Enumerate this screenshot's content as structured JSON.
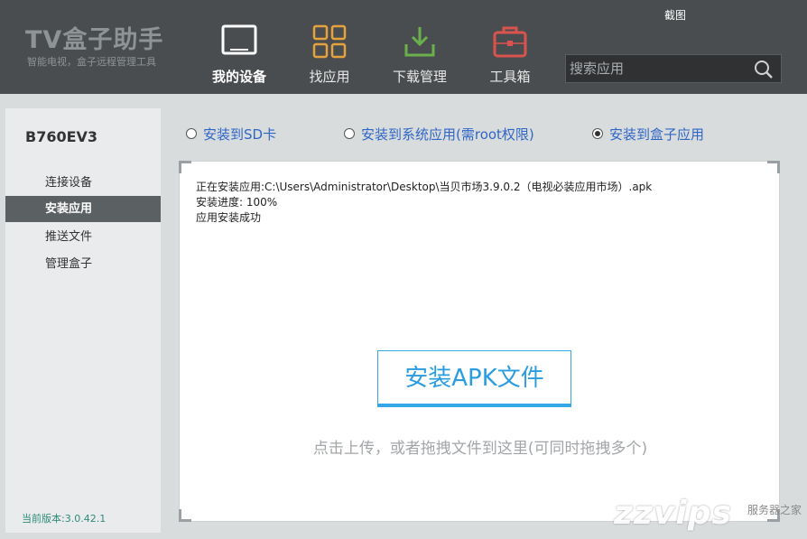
{
  "header": {
    "logo_title": "TV盒子助手",
    "logo_subtitle": "智能电视，盒子远程管理工具",
    "screenshot_label": "截图",
    "search_placeholder": "搜索应用",
    "nav": [
      {
        "label": "我的设备",
        "icon": "tv-icon",
        "active": true
      },
      {
        "label": "找应用",
        "icon": "grid-icon",
        "active": false
      },
      {
        "label": "下载管理",
        "icon": "download-icon",
        "active": false
      },
      {
        "label": "工具箱",
        "icon": "toolbox-icon",
        "active": false
      }
    ],
    "accent_color": "#e6a23c"
  },
  "sidebar": {
    "device_name": "B760EV3",
    "items": [
      {
        "label": "连接设备",
        "active": false
      },
      {
        "label": "安装应用",
        "active": true
      },
      {
        "label": "推送文件",
        "active": false
      },
      {
        "label": "管理盒子",
        "active": false
      }
    ],
    "version": "当前版本:3.0.42.1"
  },
  "install_options": [
    {
      "label": "安装到SD卡",
      "checked": false
    },
    {
      "label": "安装到系统应用(需root权限)",
      "checked": false
    },
    {
      "label": "安装到盒子应用",
      "checked": true
    }
  ],
  "log": {
    "line1": "正在安装应用:C:\\Users\\Administrator\\Desktop\\当贝市场3.9.0.2（电视必装应用市场）.apk",
    "line2": "安装进度:  100%",
    "line3": "应用安装成功"
  },
  "install_button_label": "安装APK文件",
  "drop_hint": "点击上传，或者拖拽文件到这里(可同时拖拽多个)",
  "watermark": {
    "text": "zzvips",
    "sub": "服务器之家"
  }
}
